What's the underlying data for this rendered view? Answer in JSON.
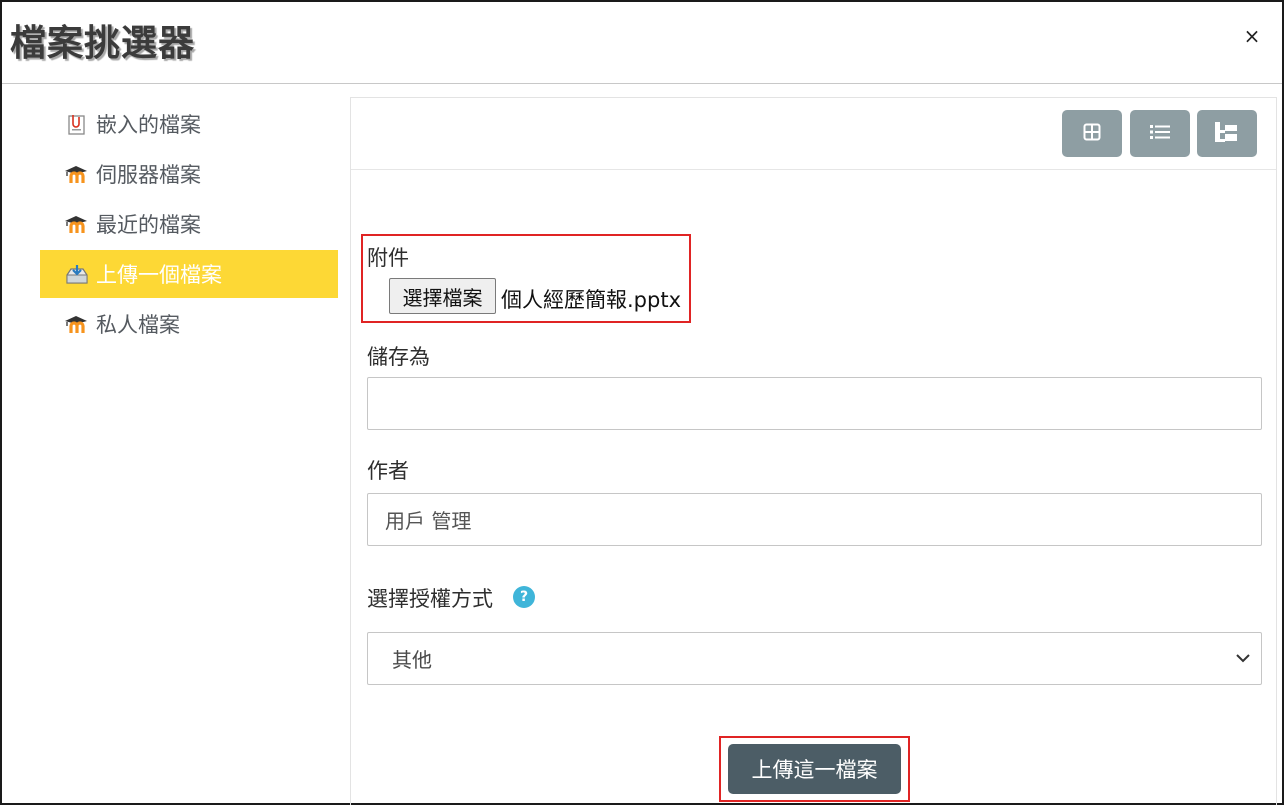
{
  "dialog": {
    "title": "檔案挑選器",
    "close_label": "×"
  },
  "sidebar": {
    "items": [
      {
        "label": "嵌入的檔案",
        "icon": "embedded-file-icon"
      },
      {
        "label": "伺服器檔案",
        "icon": "moodle-icon"
      },
      {
        "label": "最近的檔案",
        "icon": "moodle-icon"
      },
      {
        "label": "上傳一個檔案",
        "icon": "upload-icon",
        "active": true
      },
      {
        "label": "私人檔案",
        "icon": "moodle-icon"
      }
    ]
  },
  "toolbar": {
    "buttons": [
      {
        "icon": "grid-view-icon"
      },
      {
        "icon": "list-view-icon"
      },
      {
        "icon": "tree-view-icon"
      }
    ],
    "color": "#8e9ea3"
  },
  "form": {
    "attachment_label": "附件",
    "choose_file_label": "選擇檔案",
    "chosen_file": "個人經歷簡報.pptx",
    "save_as_label": "儲存為",
    "save_as_value": "",
    "author_label": "作者",
    "author_value": "用戶 管理",
    "license_label": "選擇授權方式",
    "license_value": "其他",
    "upload_button_label": "上傳這一檔案"
  },
  "colors": {
    "active_nav": "#fdd835",
    "upload_button": "#4c5d66",
    "help_icon": "#3fb5d9",
    "highlight_box": "#e02424"
  }
}
